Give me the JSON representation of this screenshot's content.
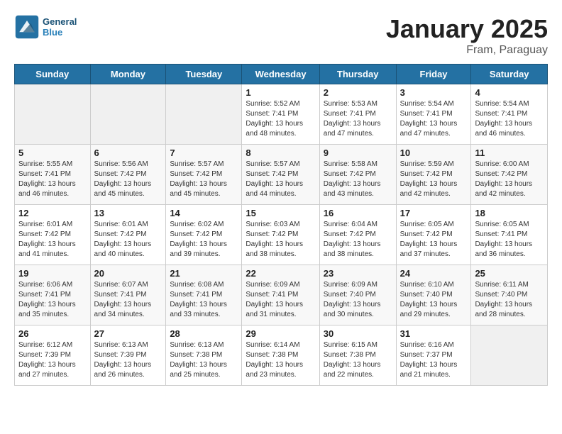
{
  "header": {
    "logo_line1": "General",
    "logo_line2": "Blue",
    "month": "January 2025",
    "location": "Fram, Paraguay"
  },
  "days_of_week": [
    "Sunday",
    "Monday",
    "Tuesday",
    "Wednesday",
    "Thursday",
    "Friday",
    "Saturday"
  ],
  "weeks": [
    [
      {
        "day": "",
        "info": ""
      },
      {
        "day": "",
        "info": ""
      },
      {
        "day": "",
        "info": ""
      },
      {
        "day": "1",
        "info": "Sunrise: 5:52 AM\nSunset: 7:41 PM\nDaylight: 13 hours\nand 48 minutes."
      },
      {
        "day": "2",
        "info": "Sunrise: 5:53 AM\nSunset: 7:41 PM\nDaylight: 13 hours\nand 47 minutes."
      },
      {
        "day": "3",
        "info": "Sunrise: 5:54 AM\nSunset: 7:41 PM\nDaylight: 13 hours\nand 47 minutes."
      },
      {
        "day": "4",
        "info": "Sunrise: 5:54 AM\nSunset: 7:41 PM\nDaylight: 13 hours\nand 46 minutes."
      }
    ],
    [
      {
        "day": "5",
        "info": "Sunrise: 5:55 AM\nSunset: 7:41 PM\nDaylight: 13 hours\nand 46 minutes."
      },
      {
        "day": "6",
        "info": "Sunrise: 5:56 AM\nSunset: 7:42 PM\nDaylight: 13 hours\nand 45 minutes."
      },
      {
        "day": "7",
        "info": "Sunrise: 5:57 AM\nSunset: 7:42 PM\nDaylight: 13 hours\nand 45 minutes."
      },
      {
        "day": "8",
        "info": "Sunrise: 5:57 AM\nSunset: 7:42 PM\nDaylight: 13 hours\nand 44 minutes."
      },
      {
        "day": "9",
        "info": "Sunrise: 5:58 AM\nSunset: 7:42 PM\nDaylight: 13 hours\nand 43 minutes."
      },
      {
        "day": "10",
        "info": "Sunrise: 5:59 AM\nSunset: 7:42 PM\nDaylight: 13 hours\nand 42 minutes."
      },
      {
        "day": "11",
        "info": "Sunrise: 6:00 AM\nSunset: 7:42 PM\nDaylight: 13 hours\nand 42 minutes."
      }
    ],
    [
      {
        "day": "12",
        "info": "Sunrise: 6:01 AM\nSunset: 7:42 PM\nDaylight: 13 hours\nand 41 minutes."
      },
      {
        "day": "13",
        "info": "Sunrise: 6:01 AM\nSunset: 7:42 PM\nDaylight: 13 hours\nand 40 minutes."
      },
      {
        "day": "14",
        "info": "Sunrise: 6:02 AM\nSunset: 7:42 PM\nDaylight: 13 hours\nand 39 minutes."
      },
      {
        "day": "15",
        "info": "Sunrise: 6:03 AM\nSunset: 7:42 PM\nDaylight: 13 hours\nand 38 minutes."
      },
      {
        "day": "16",
        "info": "Sunrise: 6:04 AM\nSunset: 7:42 PM\nDaylight: 13 hours\nand 38 minutes."
      },
      {
        "day": "17",
        "info": "Sunrise: 6:05 AM\nSunset: 7:42 PM\nDaylight: 13 hours\nand 37 minutes."
      },
      {
        "day": "18",
        "info": "Sunrise: 6:05 AM\nSunset: 7:41 PM\nDaylight: 13 hours\nand 36 minutes."
      }
    ],
    [
      {
        "day": "19",
        "info": "Sunrise: 6:06 AM\nSunset: 7:41 PM\nDaylight: 13 hours\nand 35 minutes."
      },
      {
        "day": "20",
        "info": "Sunrise: 6:07 AM\nSunset: 7:41 PM\nDaylight: 13 hours\nand 34 minutes."
      },
      {
        "day": "21",
        "info": "Sunrise: 6:08 AM\nSunset: 7:41 PM\nDaylight: 13 hours\nand 33 minutes."
      },
      {
        "day": "22",
        "info": "Sunrise: 6:09 AM\nSunset: 7:41 PM\nDaylight: 13 hours\nand 31 minutes."
      },
      {
        "day": "23",
        "info": "Sunrise: 6:09 AM\nSunset: 7:40 PM\nDaylight: 13 hours\nand 30 minutes."
      },
      {
        "day": "24",
        "info": "Sunrise: 6:10 AM\nSunset: 7:40 PM\nDaylight: 13 hours\nand 29 minutes."
      },
      {
        "day": "25",
        "info": "Sunrise: 6:11 AM\nSunset: 7:40 PM\nDaylight: 13 hours\nand 28 minutes."
      }
    ],
    [
      {
        "day": "26",
        "info": "Sunrise: 6:12 AM\nSunset: 7:39 PM\nDaylight: 13 hours\nand 27 minutes."
      },
      {
        "day": "27",
        "info": "Sunrise: 6:13 AM\nSunset: 7:39 PM\nDaylight: 13 hours\nand 26 minutes."
      },
      {
        "day": "28",
        "info": "Sunrise: 6:13 AM\nSunset: 7:38 PM\nDaylight: 13 hours\nand 25 minutes."
      },
      {
        "day": "29",
        "info": "Sunrise: 6:14 AM\nSunset: 7:38 PM\nDaylight: 13 hours\nand 23 minutes."
      },
      {
        "day": "30",
        "info": "Sunrise: 6:15 AM\nSunset: 7:38 PM\nDaylight: 13 hours\nand 22 minutes."
      },
      {
        "day": "31",
        "info": "Sunrise: 6:16 AM\nSunset: 7:37 PM\nDaylight: 13 hours\nand 21 minutes."
      },
      {
        "day": "",
        "info": ""
      }
    ]
  ]
}
